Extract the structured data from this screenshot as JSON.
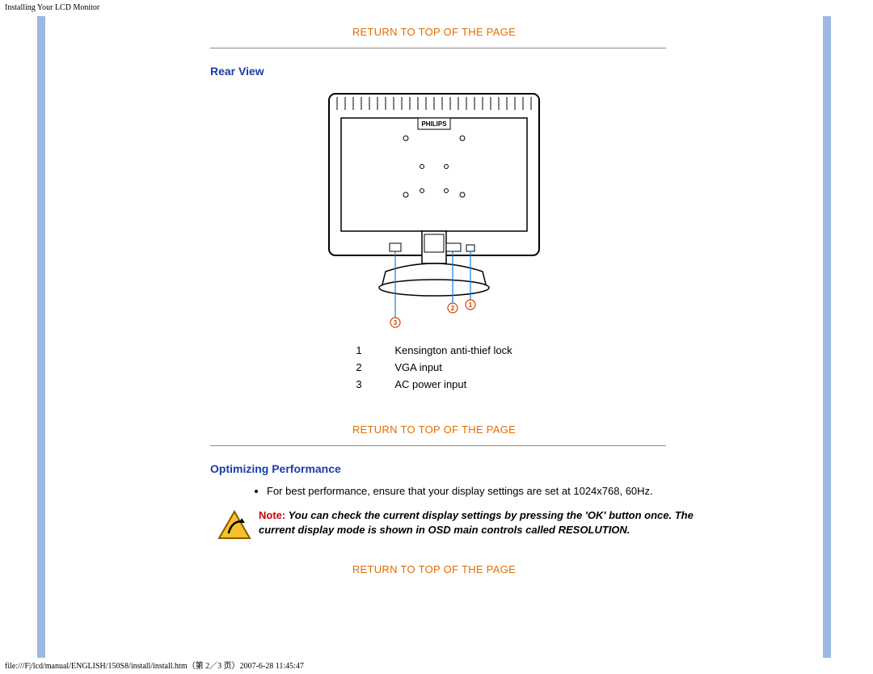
{
  "page_header": "Installing Your LCD Monitor",
  "page_footer": "file:///F|/lcd/manual/ENGLISH/150S8/install/install.htm（第 2／3 页）2007-6-28 11:45:47",
  "links": {
    "return_top": "RETURN TO TOP OF THE PAGE"
  },
  "sections": {
    "rear_view": {
      "title": "Rear View",
      "legend": [
        {
          "num": "1",
          "label": "Kensington anti-thief lock"
        },
        {
          "num": "2",
          "label": "VGA input"
        },
        {
          "num": "3",
          "label": "AC power input"
        }
      ]
    },
    "optimizing": {
      "title": "Optimizing Performance",
      "bullet": "For best performance, ensure that your display settings are set at 1024x768, 60Hz.",
      "note_label": "Note:",
      "note": " You can check the current display settings by pressing the 'OK' button once. The current display mode is shown in OSD main controls called RESOLUTION."
    }
  },
  "diagram": {
    "brand": "PHILIPS",
    "callouts": {
      "c1": "1",
      "c2": "2",
      "c3": "3"
    }
  }
}
